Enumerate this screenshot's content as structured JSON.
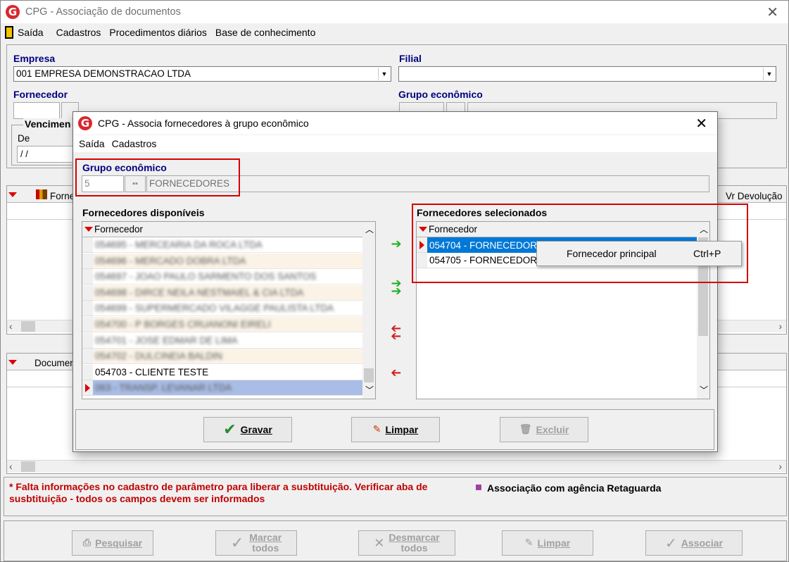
{
  "main": {
    "title": "CPG - Associação de documentos",
    "menu": [
      "Saída",
      "Cadastros",
      "Procedimentos diários",
      "Base de conhecimento"
    ],
    "empresa_label": "Empresa",
    "empresa_value": "001 EMPRESA DEMONSTRACAO LTDA",
    "filial_label": "Filial",
    "filial_value": "",
    "fornecedor_label": "Fornecedor",
    "grupo_label": "Grupo econômico",
    "vencimento_label": "Vencimen",
    "de_label": "De",
    "de_value": " / /",
    "grid1_col_fornecedor": "Forne",
    "grid1_col_devolucao": "Vr Devolução",
    "grid2_col_documento": "Documen",
    "warning_text": "* Falta informações no cadastro de parâmetro para liberar a susbtituição. Verificar aba de susbtituição - todos os campos devem ser informados",
    "legend_text": "Associação com agência Retaguarda",
    "legend_color": "#a040a0",
    "buttons": {
      "pesquisar": "Pesquisar",
      "marcar_1": "Marcar",
      "marcar_2": "todos",
      "desmarcar_1": "Desmarcar",
      "desmarcar_2": "todos",
      "limpar": "Limpar",
      "associar": "Associar"
    }
  },
  "dialog": {
    "title": "CPG - Associa fornecedores à grupo econômico",
    "menu": [
      "Saída",
      "Cadastros"
    ],
    "grupo_label": "Grupo econômico",
    "grupo_code": "5",
    "grupo_name": "FORNECEDORES",
    "disponiveis_label": "Fornecedores disponíveis",
    "selecionados_label": "Fornecedores selecionados",
    "col_fornecedor": "Fornecedor",
    "disponiveis_rows": [
      {
        "text": "054695 - MERCEARIA DA ROCA LTDA",
        "blurred": true
      },
      {
        "text": "054696 - MERCADO DOBRA LTDA",
        "blurred": true
      },
      {
        "text": "054697 - JOAO PAULO SARMENTO DOS SANTOS",
        "blurred": true
      },
      {
        "text": "054698 - DIRCE NEILA NESTMAIEL & CIA LTDA",
        "blurred": true
      },
      {
        "text": "054699 - SUPERMERCADO VILAGGE PAULISTA LTDA",
        "blurred": true
      },
      {
        "text": "054700 - P BORGES CRUANONI EIRELI",
        "blurred": true
      },
      {
        "text": "054701 - JOSE EDMAR DE LIMA",
        "blurred": true
      },
      {
        "text": "054702 - DULCINEIA BALDIN",
        "blurred": true
      },
      {
        "text": "054703 - CLIENTE TESTE",
        "blurred": false
      },
      {
        "text": "063 - TRANSP. LEVANAR LTDA",
        "blurred": true
      }
    ],
    "selecionados_rows": [
      "054704 - FORNECEDOR",
      "054705 - FORNECEDOR"
    ],
    "context_menu": {
      "label": "Fornecedor principal",
      "shortcut": "Ctrl+P"
    },
    "buttons": {
      "gravar": "Gravar",
      "limpar": "Limpar",
      "excluir": "Excluir"
    }
  }
}
